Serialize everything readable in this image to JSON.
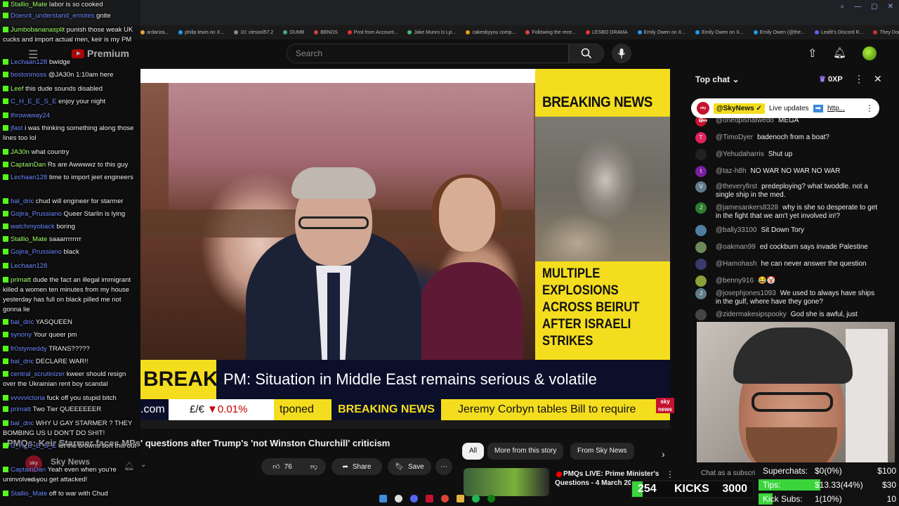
{
  "browser": {
    "bookmarks": [
      "ardariza...",
      "philip lewis on X...",
      "10: clesool57.2",
      "OUMB",
      "BBNOS",
      "Post from Account...",
      "Jake Munro is Lyi...",
      "cakesbyyou comp...",
      "Following the rece...",
      "LESBO DRAMA",
      "Emily Owen on X...",
      "Emily Owen on X...",
      "Emily Owen (@the...",
      "Leafit's Discord R...",
      "They Don't Want..."
    ]
  },
  "youtube": {
    "logo_text": "Premium",
    "search_placeholder": "Search",
    "video_title": "PMQs: Keir Starmer faces MPs' questions after Trump's 'not Winston Churchill' criticism",
    "channel_name": "Sky News",
    "channel_avatar": "sky news",
    "like_count": "76",
    "share_label": "Share",
    "save_label": "Save",
    "chips": [
      "All",
      "More from this story",
      "From Sky News"
    ],
    "recommended": {
      "title": "PMQs LIVE: Prime Minister's Questions - 4 March 20"
    }
  },
  "video": {
    "right_title": "BREAKING NEWS",
    "right_headline": "MULTIPLE EXPLOSIONS ACROSS BEIRUT AFTER ISRAELI STRIKES",
    "lower_label": "BREAKING NEWS",
    "lower_text": "PM: Situation in Middle East remains serious & volatile",
    "ticker_com": ".com",
    "ticker_fx": "£/€",
    "ticker_fx_val": "▼0.01%",
    "ticker_t1": "tponed",
    "ticker_bn": "BREAKING NEWS",
    "ticker_t2": "Jeremy Corbyn tables Bill to require",
    "sky_badge": "sky news"
  },
  "live_chat": {
    "header": "Top chat",
    "xp": "0XP",
    "pinned": {
      "channel": "@SkyNews",
      "text": "Live updates",
      "link": "http..."
    },
    "messages": [
      {
        "initial": "O",
        "color": "#c4122f",
        "user": "@onedpisnatwedo",
        "text": "MEGA"
      },
      {
        "initial": "T",
        "color": "#e0245e",
        "user": "@TimoDyer",
        "text": "badenoch from a boat?"
      },
      {
        "initial": "",
        "color": "#222222",
        "user": "@Yehudaharris",
        "text": "Shut up"
      },
      {
        "initial": "t",
        "color": "#7b1fa2",
        "user": "@taz-h8h",
        "text": "NO WAR NO WAR NO WAR"
      },
      {
        "initial": "V",
        "color": "#607d8b",
        "user": "@theveryfirst",
        "text": "predeploying? what twoddle. not a single ship in the med."
      },
      {
        "initial": "J",
        "color": "#2e7d32",
        "user": "@jamesankers8328",
        "text": "why is she so desperate to get in the fight that we am't yet involved in!?"
      },
      {
        "initial": "",
        "color": "#4f7f9f",
        "user": "@bally33100",
        "text": "Sit Down Tory"
      },
      {
        "initial": "",
        "color": "#6a8a5a",
        "user": "@oakman99",
        "text": "ed cockburn says invade Palestine"
      },
      {
        "initial": "",
        "color": "#3b3b6b",
        "user": "@Hamohash",
        "text": "he can never answer the question"
      },
      {
        "initial": "",
        "color": "#8aa03a",
        "user": "@benny916",
        "text": "😂🤡"
      },
      {
        "initial": "J",
        "color": "#607d8b",
        "user": "@josephjones1093",
        "text": "We used to always have ships in the gulf, where have they gone?"
      },
      {
        "initial": "",
        "color": "#444444",
        "user": "@zidermakesipspooky",
        "text": "God she is awful, just"
      }
    ],
    "input_placeholder": "Chat as a subscri"
  },
  "stats": {
    "superchats_label": "Superchats:",
    "superchats_val": "$0(0%)",
    "superchats_target": "$100",
    "superchats_fraction": 0,
    "tips_label": "Tips:",
    "tips_val": "$13.33(44%)",
    "tips_target": "$30",
    "tips_fraction": 0.44,
    "subs_label": "Kick Subs:",
    "subs_val": "1(10%)",
    "subs_target": "10",
    "subs_fraction": 0.1,
    "kicks_current": "254",
    "kicks_label": "KICKS",
    "kicks_goal": "3000",
    "kicks_fraction": 0.085
  },
  "kick_chat": [
    {
      "user": "Stallio_Mate",
      "text": "labor is so cooked",
      "c": ""
    },
    {
      "user": "Doesnt_understand_emotes",
      "text": "gnite",
      "c": "c2"
    },
    {
      "user": "Jumbobananasplit",
      "text": "punish those weak UK cucks and import actual men, keir is my PM",
      "c": ""
    },
    {
      "user": "Lechaan128",
      "text": "bwidge",
      "c": "c2"
    },
    {
      "user": "bostonmoss",
      "text": "@JA30n 1:10am here",
      "c": "c2"
    },
    {
      "user": "Leef",
      "text": "this dude sounds disabled",
      "c": ""
    },
    {
      "user": "C_H_E_E_S_E",
      "text": "enjoy your night",
      "c": "c2"
    },
    {
      "user": "throwaway24",
      "text": "",
      "c": "c2"
    },
    {
      "user": "jfast",
      "text": "i was thinking something along those lines too lol",
      "c": "c2"
    },
    {
      "user": "JA30n",
      "text": "what country",
      "c": ""
    },
    {
      "user": "CaptainDan",
      "text": "Rs are Awwwwz to this guy",
      "c": ""
    },
    {
      "user": "Lechaan128",
      "text": "time to import jeet engineers",
      "c": "c2"
    },
    {
      "user": "bal_dric",
      "text": "chud will engineer for starmer",
      "c": "c2"
    },
    {
      "user": "Gojira_Prussiano",
      "text": "Queer Starlin is lying",
      "c": "c2"
    },
    {
      "user": "watchmyoback",
      "text": "boring",
      "c": "c2"
    },
    {
      "user": "Stallio_Mate",
      "text": "saaarrrrrrrr",
      "c": ""
    },
    {
      "user": "Gojira_Prussiano",
      "text": "black",
      "c": "c2"
    },
    {
      "user": "Lechaan128",
      "text": "",
      "c": "c2"
    },
    {
      "user": "primatt",
      "text": "dude the fact an illegal immigrant killed a women ten minutes from my house yesterday has full on black pilled me not gonna lie",
      "c": ""
    },
    {
      "user": "bal_dric",
      "text": "YASQUEEN",
      "c": "c2"
    },
    {
      "user": "synony",
      "text": "Your queer pm",
      "c": "c2"
    },
    {
      "user": "fr0stymeddy",
      "text": "TRANS?????",
      "c": "c2"
    },
    {
      "user": "bal_dric",
      "text": "DECLARE WAR!!",
      "c": "c2"
    },
    {
      "user": "central_scrutinizer",
      "text": "kweer should resign over the Ukrainian rent boy scandal",
      "c": "c2"
    },
    {
      "user": "vvvvvictoria",
      "text": "fuck off you stupid bitch",
      "c": "c2"
    },
    {
      "user": "primatt",
      "text": "Two Tier QUEEEEEER",
      "c": "c2"
    },
    {
      "user": "bal_dric",
      "text": "WHY U GAY STARMER ? THEY BOMBING US U DON'T DO SHIT!",
      "c": "c2"
    },
    {
      "user": "C_H_E_E_S_E",
      "text": "let the browns sort this out",
      "c": "c2"
    },
    {
      "user": "CaptainDan",
      "text": "Yeah even when you're uninvolved you get attacked!",
      "c": "c2"
    },
    {
      "user": "Stallio_Mate",
      "text": "off to war with Chud",
      "c": "c2"
    }
  ]
}
